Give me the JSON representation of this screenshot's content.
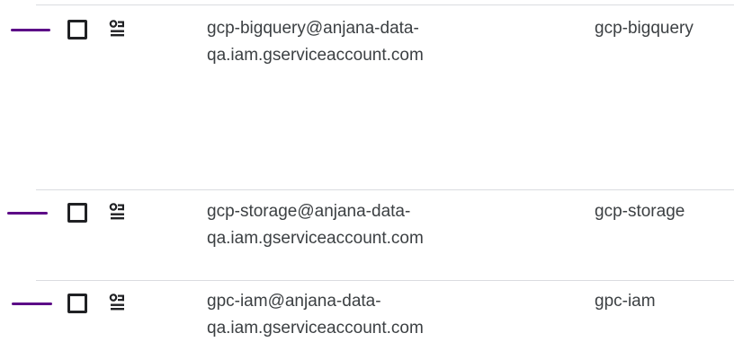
{
  "colors": {
    "marker": "#5c0a87",
    "divider": "#dadce0",
    "text": "#3c4043",
    "checkbox_border": "#202124"
  },
  "rows": [
    {
      "email_line1": "gcp-bigquery@anjana-data-",
      "email_line2": "qa.iam.gserviceaccount.com",
      "name": "gcp-bigquery",
      "icon": "service-account-icon",
      "checked": false
    },
    {
      "email_line1": "gcp-storage@anjana-data-",
      "email_line2": "qa.iam.gserviceaccount.com",
      "name": "gcp-storage",
      "icon": "service-account-icon",
      "checked": false
    },
    {
      "email_line1": "gpc-iam@anjana-data-",
      "email_line2": "qa.iam.gserviceaccount.com",
      "name": "gpc-iam",
      "icon": "service-account-icon",
      "checked": false
    }
  ]
}
